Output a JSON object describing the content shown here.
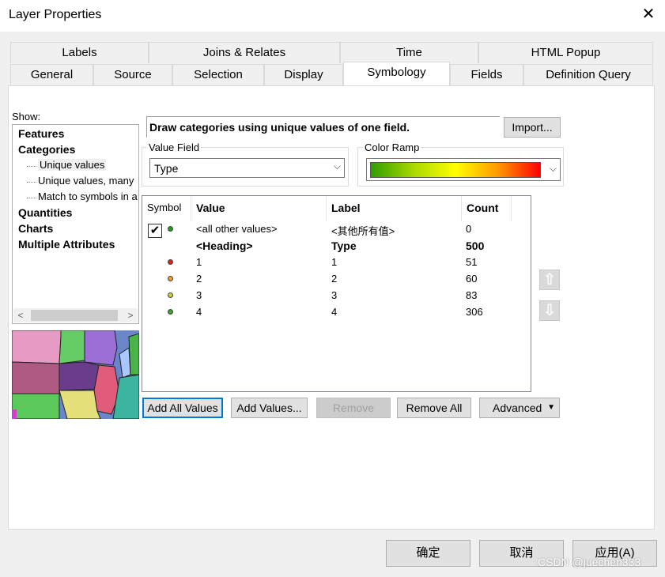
{
  "window": {
    "title": "Layer Properties",
    "close_icon": "close-icon"
  },
  "tabs_row1": [
    "Labels",
    "Joins & Relates",
    "Time",
    "HTML Popup"
  ],
  "tabs_row2": [
    "General",
    "Source",
    "Selection",
    "Display",
    "Symbology",
    "Fields",
    "Definition Query"
  ],
  "active_tab": "Symbology",
  "show": {
    "label": "Show:",
    "items": [
      {
        "label": "Features",
        "style": "bold"
      },
      {
        "label": "Categories",
        "style": "bold"
      },
      {
        "label": "Unique values",
        "style": "sub",
        "selected": true
      },
      {
        "label": "Unique values, many",
        "style": "sub"
      },
      {
        "label": "Match to symbols in a",
        "style": "sub"
      },
      {
        "label": "Quantities",
        "style": "bold"
      },
      {
        "label": "Charts",
        "style": "bold"
      },
      {
        "label": "Multiple Attributes",
        "style": "bold"
      }
    ]
  },
  "description": "Draw categories using unique values of one field.",
  "import_button": "Import...",
  "value_field": {
    "title": "Value Field",
    "value": "Type"
  },
  "color_ramp": {
    "title": "Color Ramp",
    "colors": [
      "#2e9e00",
      "#a8d800",
      "#ffff00",
      "#ff9900",
      "#ff0000"
    ]
  },
  "table": {
    "headers": [
      "Symbol",
      "Value",
      "Label",
      "Count"
    ],
    "rows": [
      {
        "symbol_color": "#1e9e1e",
        "checkbox": true,
        "value": "<all other values>",
        "label": "<其他所有值>",
        "count": "0",
        "style": "small"
      },
      {
        "symbol_color": "",
        "value": "<Heading>",
        "label": "Type",
        "count": "500",
        "style": "bold"
      },
      {
        "symbol_color": "#e02020",
        "value": "1",
        "label": "1",
        "count": "51",
        "style": "small"
      },
      {
        "symbol_color": "#f0a020",
        "value": "2",
        "label": "2",
        "count": "60",
        "style": "small"
      },
      {
        "symbol_color": "#d0d020",
        "value": "3",
        "label": "3",
        "count": "83",
        "style": "small"
      },
      {
        "symbol_color": "#3aa030",
        "value": "4",
        "label": "4",
        "count": "306",
        "style": "small"
      }
    ]
  },
  "action_buttons": [
    "Add All Values",
    "Add Values...",
    "Remove",
    "Remove All",
    "Advanced"
  ],
  "dialog_buttons": [
    "确定",
    "取消",
    "应用(A)"
  ],
  "watermark": "CSDN @juechen333"
}
